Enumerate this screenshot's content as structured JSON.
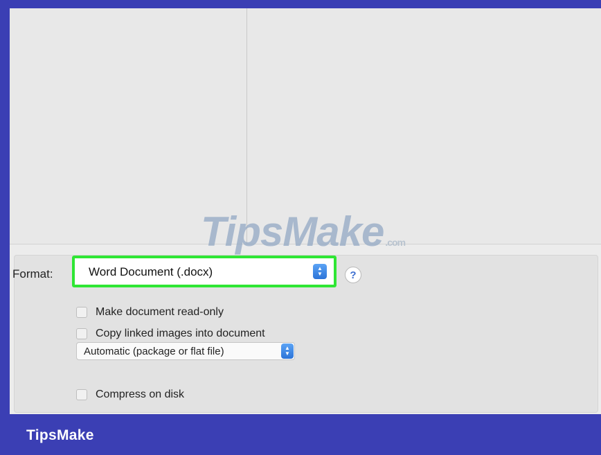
{
  "browser": {},
  "watermark": {
    "text": "TipsMake",
    "suffix": ".com"
  },
  "options": {
    "format_label": "Format:",
    "format_value": "Word Document (.docx)",
    "help_label": "?",
    "read_only_label": "Make document read-only",
    "copy_images_label": "Copy linked images into document",
    "package_value": "Automatic (package or flat file)",
    "compress_label": "Compress on disk"
  },
  "colors": {
    "highlight": "#2fe634",
    "accent": "#2c74d8",
    "frame": "#3b3fb4"
  },
  "footer": {
    "brand": "TipsMake"
  }
}
